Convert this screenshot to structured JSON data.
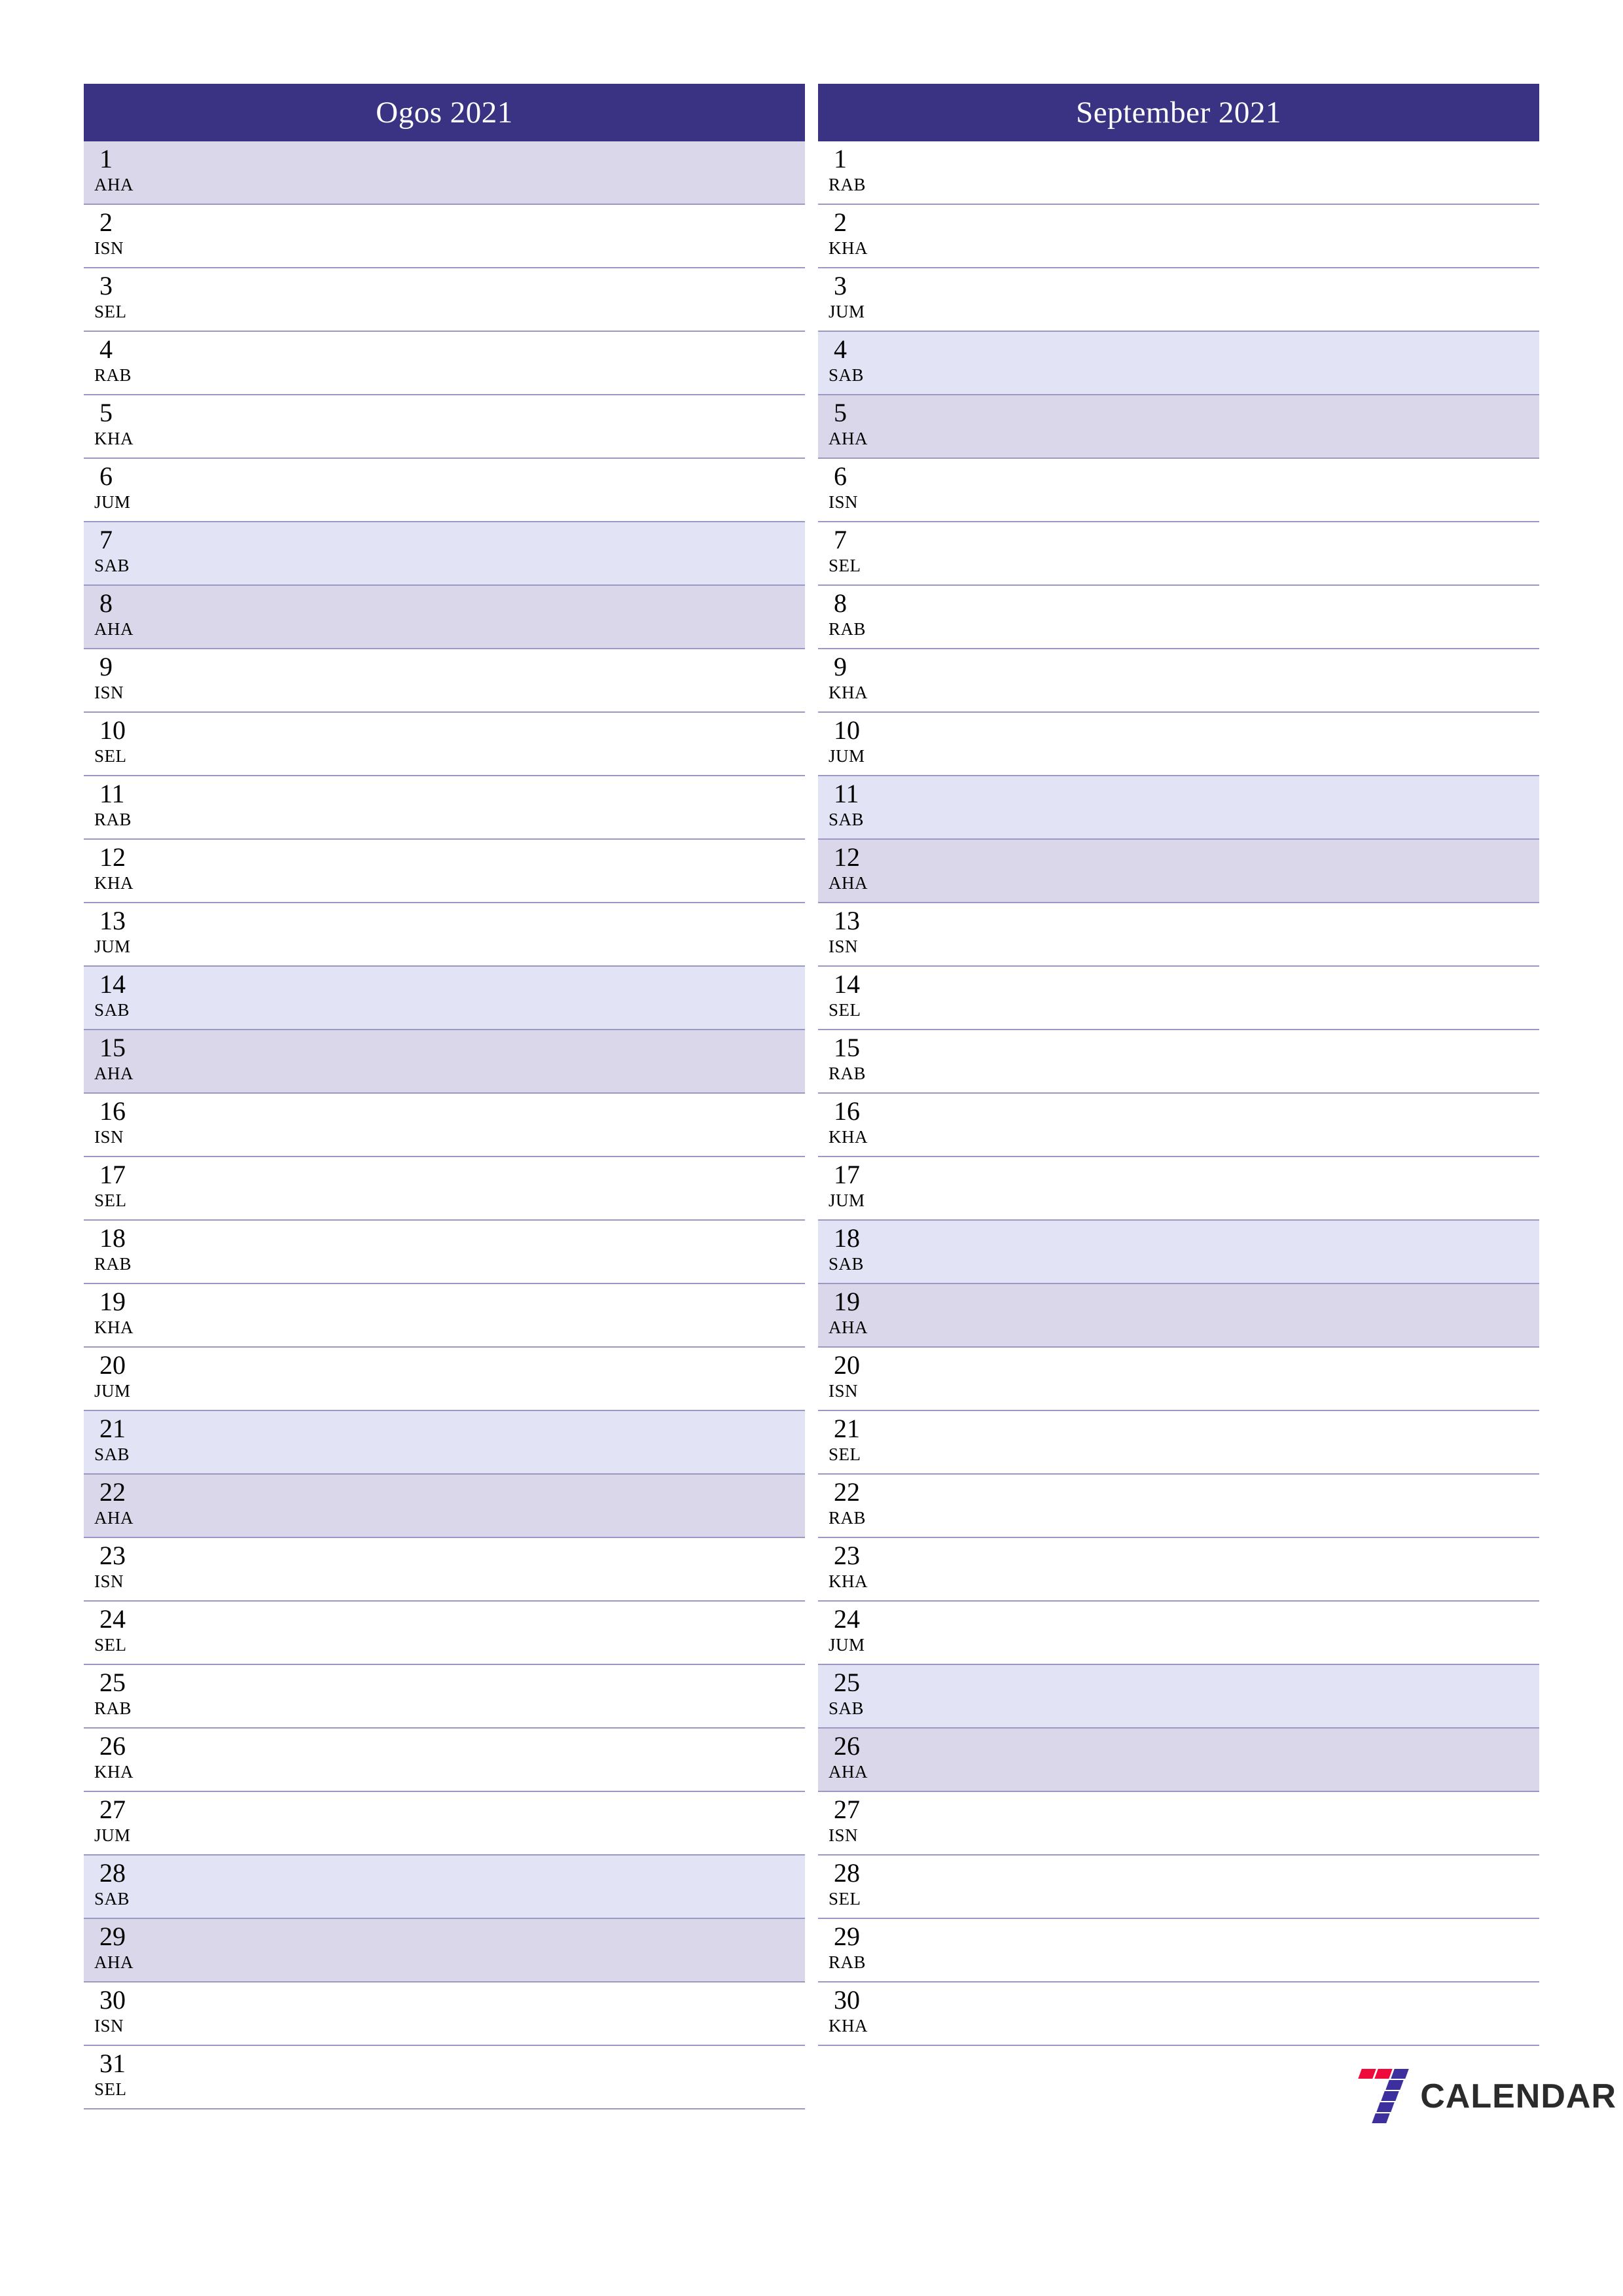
{
  "document": {
    "type": "monthly-planner",
    "year": "2021",
    "language": "ms"
  },
  "colors": {
    "header_bg": "#3a3383",
    "header_text": "#ffffff",
    "saturday_bg": "#e3e3f6",
    "sunday_bg": "#dbd7ea",
    "row_divider": "#9c98c4",
    "logo_red": "#ee0b3c",
    "logo_blue": "#3d2f9e",
    "logo_text": "#2b2b2b"
  },
  "months": [
    {
      "title": "Ogos 2021",
      "days": [
        {
          "num": "1",
          "name": "AHA",
          "kind": "sun"
        },
        {
          "num": "2",
          "name": "ISN",
          "kind": "weekday"
        },
        {
          "num": "3",
          "name": "SEL",
          "kind": "weekday"
        },
        {
          "num": "4",
          "name": "RAB",
          "kind": "weekday"
        },
        {
          "num": "5",
          "name": "KHA",
          "kind": "weekday"
        },
        {
          "num": "6",
          "name": "JUM",
          "kind": "weekday"
        },
        {
          "num": "7",
          "name": "SAB",
          "kind": "sat"
        },
        {
          "num": "8",
          "name": "AHA",
          "kind": "sun"
        },
        {
          "num": "9",
          "name": "ISN",
          "kind": "weekday"
        },
        {
          "num": "10",
          "name": "SEL",
          "kind": "weekday"
        },
        {
          "num": "11",
          "name": "RAB",
          "kind": "weekday"
        },
        {
          "num": "12",
          "name": "KHA",
          "kind": "weekday"
        },
        {
          "num": "13",
          "name": "JUM",
          "kind": "weekday"
        },
        {
          "num": "14",
          "name": "SAB",
          "kind": "sat"
        },
        {
          "num": "15",
          "name": "AHA",
          "kind": "sun"
        },
        {
          "num": "16",
          "name": "ISN",
          "kind": "weekday"
        },
        {
          "num": "17",
          "name": "SEL",
          "kind": "weekday"
        },
        {
          "num": "18",
          "name": "RAB",
          "kind": "weekday"
        },
        {
          "num": "19",
          "name": "KHA",
          "kind": "weekday"
        },
        {
          "num": "20",
          "name": "JUM",
          "kind": "weekday"
        },
        {
          "num": "21",
          "name": "SAB",
          "kind": "sat"
        },
        {
          "num": "22",
          "name": "AHA",
          "kind": "sun"
        },
        {
          "num": "23",
          "name": "ISN",
          "kind": "weekday"
        },
        {
          "num": "24",
          "name": "SEL",
          "kind": "weekday"
        },
        {
          "num": "25",
          "name": "RAB",
          "kind": "weekday"
        },
        {
          "num": "26",
          "name": "KHA",
          "kind": "weekday"
        },
        {
          "num": "27",
          "name": "JUM",
          "kind": "weekday"
        },
        {
          "num": "28",
          "name": "SAB",
          "kind": "sat"
        },
        {
          "num": "29",
          "name": "AHA",
          "kind": "sun"
        },
        {
          "num": "30",
          "name": "ISN",
          "kind": "weekday"
        },
        {
          "num": "31",
          "name": "SEL",
          "kind": "weekday"
        }
      ]
    },
    {
      "title": "September 2021",
      "days": [
        {
          "num": "1",
          "name": "RAB",
          "kind": "weekday"
        },
        {
          "num": "2",
          "name": "KHA",
          "kind": "weekday"
        },
        {
          "num": "3",
          "name": "JUM",
          "kind": "weekday"
        },
        {
          "num": "4",
          "name": "SAB",
          "kind": "sat"
        },
        {
          "num": "5",
          "name": "AHA",
          "kind": "sun"
        },
        {
          "num": "6",
          "name": "ISN",
          "kind": "weekday"
        },
        {
          "num": "7",
          "name": "SEL",
          "kind": "weekday"
        },
        {
          "num": "8",
          "name": "RAB",
          "kind": "weekday"
        },
        {
          "num": "9",
          "name": "KHA",
          "kind": "weekday"
        },
        {
          "num": "10",
          "name": "JUM",
          "kind": "weekday"
        },
        {
          "num": "11",
          "name": "SAB",
          "kind": "sat"
        },
        {
          "num": "12",
          "name": "AHA",
          "kind": "sun"
        },
        {
          "num": "13",
          "name": "ISN",
          "kind": "weekday"
        },
        {
          "num": "14",
          "name": "SEL",
          "kind": "weekday"
        },
        {
          "num": "15",
          "name": "RAB",
          "kind": "weekday"
        },
        {
          "num": "16",
          "name": "KHA",
          "kind": "weekday"
        },
        {
          "num": "17",
          "name": "JUM",
          "kind": "weekday"
        },
        {
          "num": "18",
          "name": "SAB",
          "kind": "sat"
        },
        {
          "num": "19",
          "name": "AHA",
          "kind": "sun"
        },
        {
          "num": "20",
          "name": "ISN",
          "kind": "weekday"
        },
        {
          "num": "21",
          "name": "SEL",
          "kind": "weekday"
        },
        {
          "num": "22",
          "name": "RAB",
          "kind": "weekday"
        },
        {
          "num": "23",
          "name": "KHA",
          "kind": "weekday"
        },
        {
          "num": "24",
          "name": "JUM",
          "kind": "weekday"
        },
        {
          "num": "25",
          "name": "SAB",
          "kind": "sat"
        },
        {
          "num": "26",
          "name": "AHA",
          "kind": "sun"
        },
        {
          "num": "27",
          "name": "ISN",
          "kind": "weekday"
        },
        {
          "num": "28",
          "name": "SEL",
          "kind": "weekday"
        },
        {
          "num": "29",
          "name": "RAB",
          "kind": "weekday"
        },
        {
          "num": "30",
          "name": "KHA",
          "kind": "weekday"
        }
      ]
    }
  ],
  "logo": {
    "text": "CALENDAR",
    "mark": "seven-logo-icon"
  }
}
